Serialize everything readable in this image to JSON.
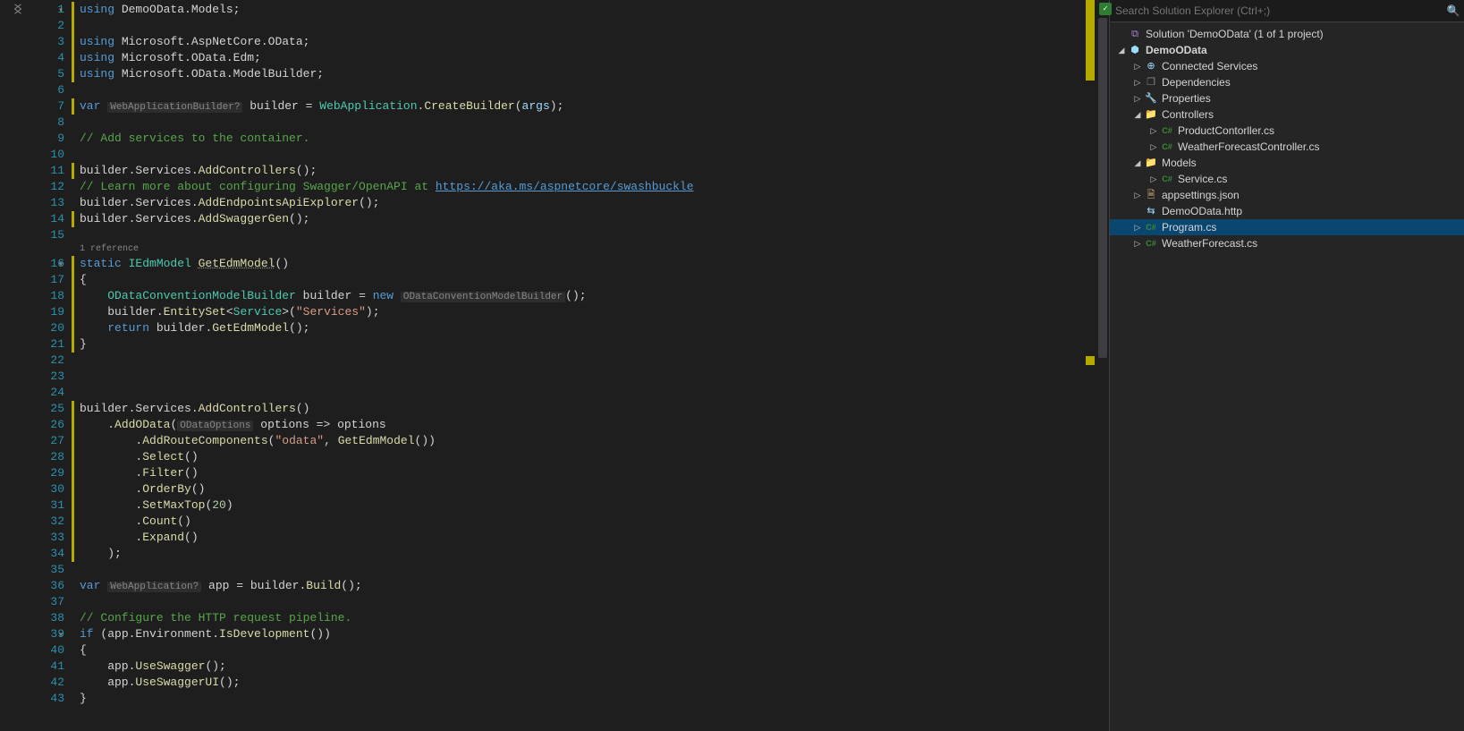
{
  "search": {
    "placeholder": "Search Solution Explorer (Ctrl+;)"
  },
  "solution": {
    "name": "Solution 'DemoOData' (1 of 1 project)",
    "project": "DemoOData",
    "nodes": {
      "connected": "Connected Services",
      "dependencies": "Dependencies",
      "properties": "Properties",
      "controllers": "Controllers",
      "productController": "ProductContorller.cs",
      "weatherController": "WeatherForecastController.cs",
      "models": "Models",
      "serviceCs": "Service.cs",
      "appsettings": "appsettings.json",
      "demoHttp": "DemoOData.http",
      "programCs": "Program.cs",
      "weatherCs": "WeatherForecast.cs"
    }
  },
  "codelens": {
    "ref": "1 reference"
  },
  "hints": {
    "webAppBuilder": "WebApplicationBuilder?",
    "oDataConv": "ODataConventionModelBuilder",
    "oDataOptions": "ODataOptions",
    "webApp": "WebApplication?"
  },
  "code": {
    "l1_a": "using",
    "l1_b": " DemoOData.Models;",
    "l3_a": "using",
    "l3_b": " Microsoft.AspNetCore.OData;",
    "l4_a": "using",
    "l4_b": " Microsoft.OData.Edm;",
    "l5_a": "using",
    "l5_b": " Microsoft.OData.ModelBuilder;",
    "l7_a": "var ",
    "l7_b": " builder = ",
    "l7_c": "WebApplication",
    "l7_d": ".",
    "l7_e": "CreateBuilder",
    "l7_f": "(",
    "l7_g": "args",
    "l7_h": ");",
    "l9": "// Add services to the container.",
    "l11_a": "builder.Services.",
    "l11_b": "AddControllers",
    "l11_c": "();",
    "l12_a": "// Learn more about configuring Swagger/OpenAPI at ",
    "l12_b": "https://aka.ms/aspnetcore/swashbuckle",
    "l13_a": "builder.Services.",
    "l13_b": "AddEndpointsApiExplorer",
    "l13_c": "();",
    "l14_a": "builder.Services.",
    "l14_b": "AddSwaggerGen",
    "l14_c": "();",
    "l16_a": "static ",
    "l16_b": "IEdmModel ",
    "l16_c": "GetEdmModel",
    "l16_d": "()",
    "l17": "{",
    "l18_a": "    ",
    "l18_b": "ODataConventionModelBuilder",
    "l18_c": " builder = ",
    "l18_d": "new ",
    "l18_e": "();",
    "l19_a": "    builder.",
    "l19_b": "EntitySet",
    "l19_c": "<",
    "l19_d": "Service",
    "l19_e": ">(",
    "l19_f": "\"Services\"",
    "l19_g": ");",
    "l20_a": "    ",
    "l20_b": "return",
    "l20_c": " builder.",
    "l20_d": "GetEdmModel",
    "l20_e": "();",
    "l21": "}",
    "l25_a": "builder.Services.",
    "l25_b": "AddControllers",
    "l25_c": "()",
    "l26_a": "    .",
    "l26_b": "AddOData",
    "l26_c": "(",
    "l26_d": " options => options",
    "l27_a": "        .",
    "l27_b": "AddRouteComponents",
    "l27_c": "(",
    "l27_d": "\"odata\"",
    "l27_e": ", ",
    "l27_f": "GetEdmModel",
    "l27_g": "())",
    "l28_a": "        .",
    "l28_b": "Select",
    "l28_c": "()",
    "l29_a": "        .",
    "l29_b": "Filter",
    "l29_c": "()",
    "l30_a": "        .",
    "l30_b": "OrderBy",
    "l30_c": "()",
    "l31_a": "        .",
    "l31_b": "SetMaxTop",
    "l31_c": "(",
    "l31_d": "20",
    "l31_e": ")",
    "l32_a": "        .",
    "l32_b": "Count",
    "l32_c": "()",
    "l33_a": "        .",
    "l33_b": "Expand",
    "l33_c": "()",
    "l34": "    );",
    "l36_a": "var ",
    "l36_b": " app = builder.",
    "l36_c": "Build",
    "l36_d": "();",
    "l38": "// Configure the HTTP request pipeline.",
    "l39_a": "if",
    "l39_b": " (app.Environment.",
    "l39_c": "IsDevelopment",
    "l39_d": "())",
    "l40": "{",
    "l41_a": "    app.",
    "l41_b": "UseSwagger",
    "l41_c": "();",
    "l42_a": "    app.",
    "l42_b": "UseSwaggerUI",
    "l42_c": "();",
    "l43": "}"
  },
  "line_numbers": [
    "1",
    "2",
    "3",
    "4",
    "5",
    "6",
    "7",
    "8",
    "9",
    "10",
    "11",
    "12",
    "13",
    "14",
    "15",
    "16",
    "17",
    "18",
    "19",
    "20",
    "21",
    "22",
    "23",
    "24",
    "25",
    "26",
    "27",
    "28",
    "29",
    "30",
    "31",
    "32",
    "33",
    "34",
    "35",
    "36",
    "37",
    "38",
    "39",
    "40",
    "41",
    "42",
    "43"
  ]
}
